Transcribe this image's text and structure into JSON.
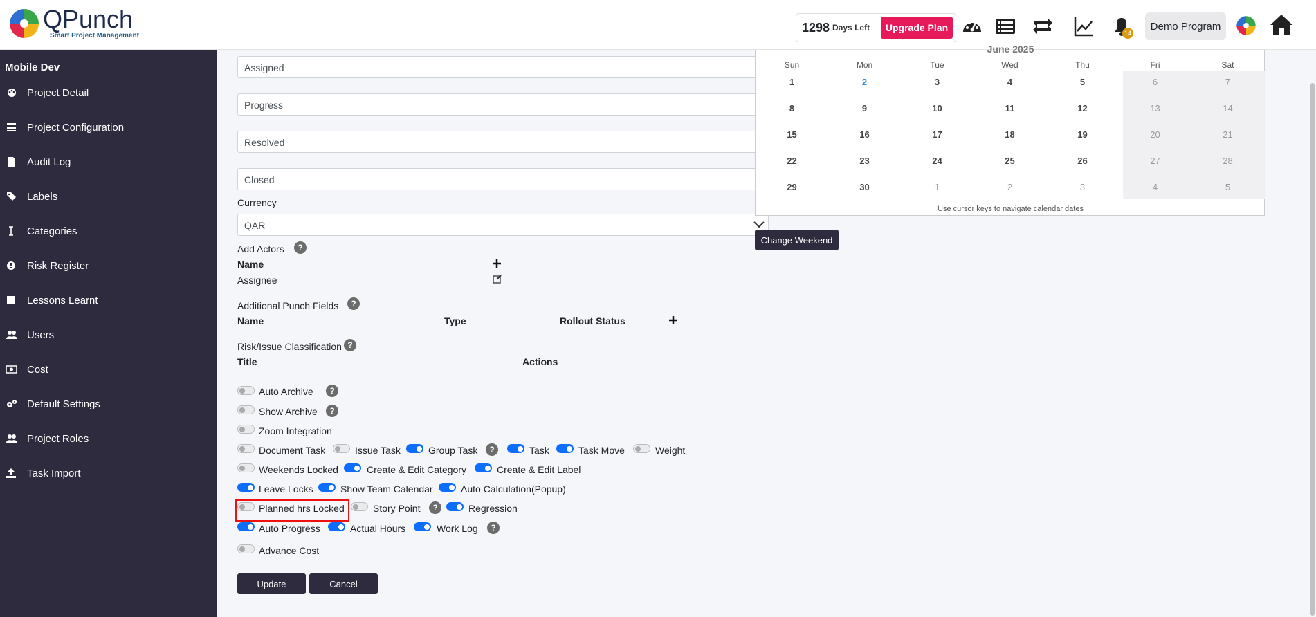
{
  "header": {
    "logo_name": "QPunch",
    "logo_tagline": "Smart Project Management",
    "days_count": "1298",
    "days_label": "Days Left",
    "upgrade_label": "Upgrade Plan",
    "notification_count": "14",
    "program_label": "Demo Program",
    "icons": [
      "dashboard-icon",
      "list-icon",
      "sync-icon",
      "chart-icon",
      "bell-icon",
      "logo-small-icon",
      "home-icon"
    ]
  },
  "sidebar": {
    "title": "Mobile Dev",
    "items": [
      {
        "label": "Project Detail",
        "icon": "palette-icon"
      },
      {
        "label": "Project Configuration",
        "icon": "config-icon"
      },
      {
        "label": "Audit Log",
        "icon": "file-icon"
      },
      {
        "label": "Labels",
        "icon": "tags-icon"
      },
      {
        "label": "Categories",
        "icon": "text-cursor-icon"
      },
      {
        "label": "Risk Register",
        "icon": "alert-icon"
      },
      {
        "label": "Lessons Learnt",
        "icon": "square-icon"
      },
      {
        "label": "Users",
        "icon": "users-icon"
      },
      {
        "label": "Cost",
        "icon": "money-icon"
      },
      {
        "label": "Default Settings",
        "icon": "cogs-icon"
      },
      {
        "label": "Project Roles",
        "icon": "roles-icon"
      },
      {
        "label": "Task Import",
        "icon": "upload-icon"
      }
    ]
  },
  "form": {
    "status_fields": [
      "Assigned",
      "Progress",
      "Resolved",
      "Closed"
    ],
    "currency_label": "Currency",
    "currency_value": "QAR",
    "add_actors_label": "Add Actors",
    "actors_name_header": "Name",
    "actors_row": "Assignee",
    "punch_fields_label": "Additional Punch Fields",
    "punch_headers": {
      "name": "Name",
      "type": "Type",
      "rollout": "Rollout Status"
    },
    "risk_label": "Risk/Issue Classification",
    "risk_headers": {
      "title": "Title",
      "actions": "Actions"
    },
    "toggles": {
      "auto_archive": {
        "label": "Auto Archive",
        "on": false
      },
      "show_archive": {
        "label": "Show Archive",
        "on": false
      },
      "zoom_integration": {
        "label": "Zoom Integration",
        "on": false
      },
      "document_task": {
        "label": "Document Task",
        "on": false
      },
      "issue_task": {
        "label": "Issue Task",
        "on": false
      },
      "group_task": {
        "label": "Group Task",
        "on": true
      },
      "task": {
        "label": "Task",
        "on": true
      },
      "task_move": {
        "label": "Task Move",
        "on": true
      },
      "weight": {
        "label": "Weight",
        "on": false
      },
      "weekends_locked": {
        "label": "Weekends Locked",
        "on": false
      },
      "create_edit_category": {
        "label": "Create & Edit Category",
        "on": true
      },
      "create_edit_label": {
        "label": "Create & Edit Label",
        "on": true
      },
      "leave_locks": {
        "label": "Leave Locks",
        "on": true
      },
      "show_team_calendar": {
        "label": "Show Team Calendar",
        "on": true
      },
      "auto_calculation": {
        "label": "Auto Calculation(Popup)",
        "on": true
      },
      "planned_hrs_locked": {
        "label": "Planned hrs Locked",
        "on": false
      },
      "story_point": {
        "label": "Story Point",
        "on": false
      },
      "regression": {
        "label": "Regression",
        "on": true
      },
      "auto_progress": {
        "label": "Auto Progress",
        "on": true
      },
      "actual_hours": {
        "label": "Actual Hours",
        "on": true
      },
      "work_log": {
        "label": "Work Log",
        "on": true
      },
      "advance_cost": {
        "label": "Advance Cost",
        "on": false
      }
    },
    "update_label": "Update",
    "cancel_label": "Cancel"
  },
  "calendar": {
    "month": "June 2025",
    "dow": [
      "Sun",
      "Mon",
      "Tue",
      "Wed",
      "Thu",
      "Fri",
      "Sat"
    ],
    "weeks": [
      [
        "1",
        "2",
        "3",
        "4",
        "5",
        "6",
        "7"
      ],
      [
        "8",
        "9",
        "10",
        "11",
        "12",
        "13",
        "14"
      ],
      [
        "15",
        "16",
        "17",
        "18",
        "19",
        "20",
        "21"
      ],
      [
        "22",
        "23",
        "24",
        "25",
        "26",
        "27",
        "28"
      ],
      [
        "29",
        "30",
        "1",
        "2",
        "3",
        "4",
        "5"
      ]
    ],
    "footer": "Use cursor keys to navigate calendar dates",
    "change_weekend_label": "Change Weekend"
  },
  "colors": {
    "sidebar": "#2d2b3d",
    "accent": "#0d6efd",
    "upgrade": "#e6195a",
    "highlight": "#e11111"
  }
}
